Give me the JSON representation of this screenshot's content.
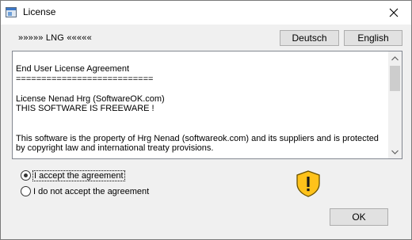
{
  "window": {
    "title": "License"
  },
  "language": {
    "label": "»»»»» LNG «««««",
    "buttons": [
      "Deutsch",
      "English"
    ]
  },
  "license": {
    "text": "End User License Agreement\n===========================\n\nLicense Nenad Hrg (SoftwareOK.com)\nTHIS SOFTWARE IS FREEWARE !\n\n\nThis software is the property of Hrg Nenad (softwareok.com) and its suppliers and is protected by copyright law and international treaty provisions."
  },
  "options": {
    "accept": "I accept the agreement",
    "decline": "I do not accept the agreement",
    "selected": "accept"
  },
  "actions": {
    "ok": "OK"
  },
  "icons": {
    "app": "window-app-icon",
    "close": "close-icon",
    "warning": "shield-warning-icon"
  },
  "colors": {
    "shield_fill": "#ffc21a",
    "shield_stroke": "#6a5200"
  }
}
